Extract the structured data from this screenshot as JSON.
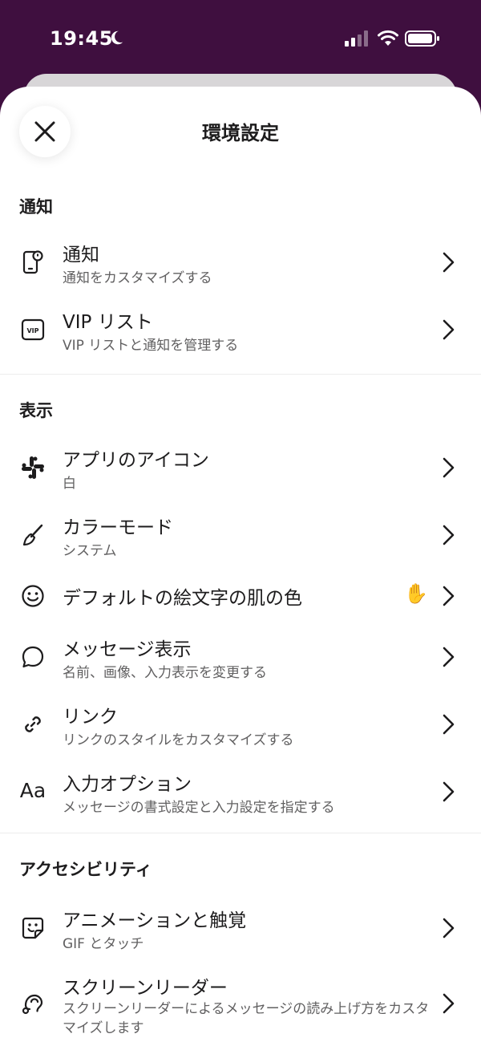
{
  "status_bar": {
    "time": "19:45"
  },
  "header": {
    "title": "環境設定"
  },
  "sections": {
    "notifications": {
      "title": "通知",
      "items": [
        {
          "label": "通知",
          "sub": "通知をカスタマイズする",
          "icon": "phone-notification-icon"
        },
        {
          "label": "VIP リスト",
          "sub": "VIP リストと通知を管理する",
          "icon": "vip-icon"
        }
      ]
    },
    "display": {
      "title": "表示",
      "items": [
        {
          "label": "アプリのアイコン",
          "sub": "白",
          "icon": "slack-logo-icon"
        },
        {
          "label": "カラーモード",
          "sub": "システム",
          "icon": "paintbrush-icon"
        },
        {
          "label": "デフォルトの絵文字の肌の色",
          "value": "✋",
          "icon": "smiley-icon"
        },
        {
          "label": "メッセージ表示",
          "sub": "名前、画像、入力表示を変更する",
          "icon": "speech-bubble-icon"
        },
        {
          "label": "リンク",
          "sub": "リンクのスタイルをカスタマイズする",
          "icon": "link-icon"
        },
        {
          "label": "入力オプション",
          "sub": "メッセージの書式設定と入力設定を指定する",
          "icon_text": "Aa"
        }
      ]
    },
    "accessibility": {
      "title": "アクセシビリティ",
      "items": [
        {
          "label": "アニメーションと触覚",
          "sub": "GIF とタッチ",
          "icon": "animated-sticker-icon"
        },
        {
          "label": "スクリーンリーダー",
          "sub": "スクリーンリーダーによるメッセージの読み上げ方をカスタマイズします",
          "icon": "screen-reader-icon"
        }
      ]
    }
  }
}
